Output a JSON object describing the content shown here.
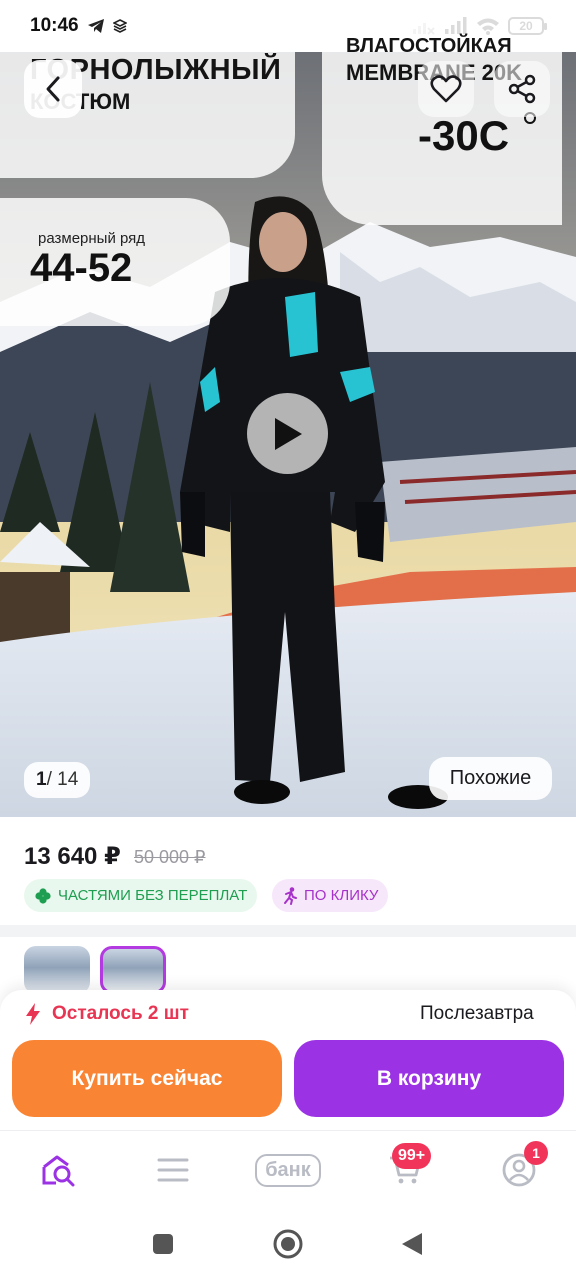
{
  "status_bar": {
    "time": "10:46",
    "battery": "20",
    "icons": [
      "telegram-icon",
      "layers-icon",
      "signal-off-icon",
      "signal-icon",
      "wifi-icon",
      "battery-icon"
    ]
  },
  "hero": {
    "title_line1": "ГОРНОЛЫЖНЫЙ",
    "title_line2": "КОСТЮМ",
    "right_line1": "ВЛАГОСТОЙКАЯ",
    "right_line2": "MEMBRANE 20K",
    "temperature": "-30C",
    "size_caption": "размерный ряд",
    "size_range": "44-52",
    "counter_current": "1",
    "counter_total": "/ 14",
    "similar_label": "Похожие"
  },
  "product": {
    "price": "13 640 ₽",
    "old_price": "50 000 ₽",
    "badge_installment": "ЧАСТЯМИ БЕЗ ПЕРЕПЛАТ",
    "badge_click": "ПО КЛИКУ"
  },
  "action_sheet": {
    "stock": "Осталось 2 шт",
    "delivery": "Послезавтра",
    "buy_now": "Купить сейчас",
    "add_to_cart": "В корзину"
  },
  "tabbar": {
    "bank_label": "банк",
    "cart_badge": "99+",
    "profile_badge": "1"
  },
  "colors": {
    "accent_purple": "#9b33e5",
    "accent_orange": "#f98433",
    "stock_red": "#e83553",
    "badge_green": "#1e9e50",
    "badge_purple": "#a732c9"
  }
}
